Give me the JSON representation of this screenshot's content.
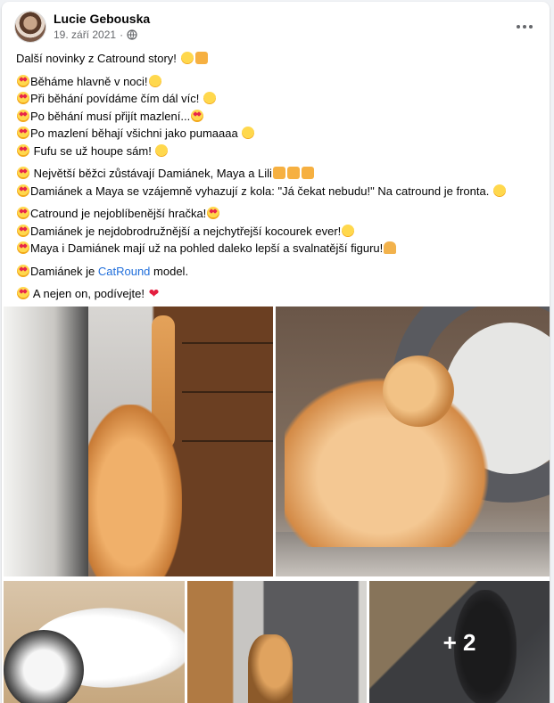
{
  "post": {
    "author": "Lucie Gebouska",
    "date": "19. září 2021",
    "privacy_icon": "globe-icon",
    "more_icon": "more-options-icon"
  },
  "content": {
    "intro": "Další novinky z Catround story!",
    "lines_a": [
      "Běháme hlavně v noci!",
      "Při běhání povídáme čím dál víc!",
      "Po běhání musí přijít mazlení...",
      "Po mazlení běhají všichni  jako pumaaaa",
      " Fufu se už houpe sám!"
    ],
    "lines_b": [
      " Největší běžci zůstávají Damiánek, Maya a Lili",
      "Damiánek a Maya se vzájemně vyhazují z kola: \"Já čekat nebudu!\" Na catround je fronta."
    ],
    "lines_c": [
      "Catround je nejoblíbenější hračka!",
      "Damiánek je nejdobrodružnější a nejchytřejší kocourek ever!",
      "Maya i Damiánek mají už na pohled daleko lepší a svalnatější figuru!"
    ],
    "model_pre": "Damiánek je ",
    "model_link": "CatRound",
    "model_post": " model.",
    "outro": " A nejen on, podívejte!"
  },
  "photos": {
    "more_count": "+ 2"
  },
  "colors": {
    "link": "#216fdb",
    "text": "#050505",
    "secondary": "#65676b"
  }
}
